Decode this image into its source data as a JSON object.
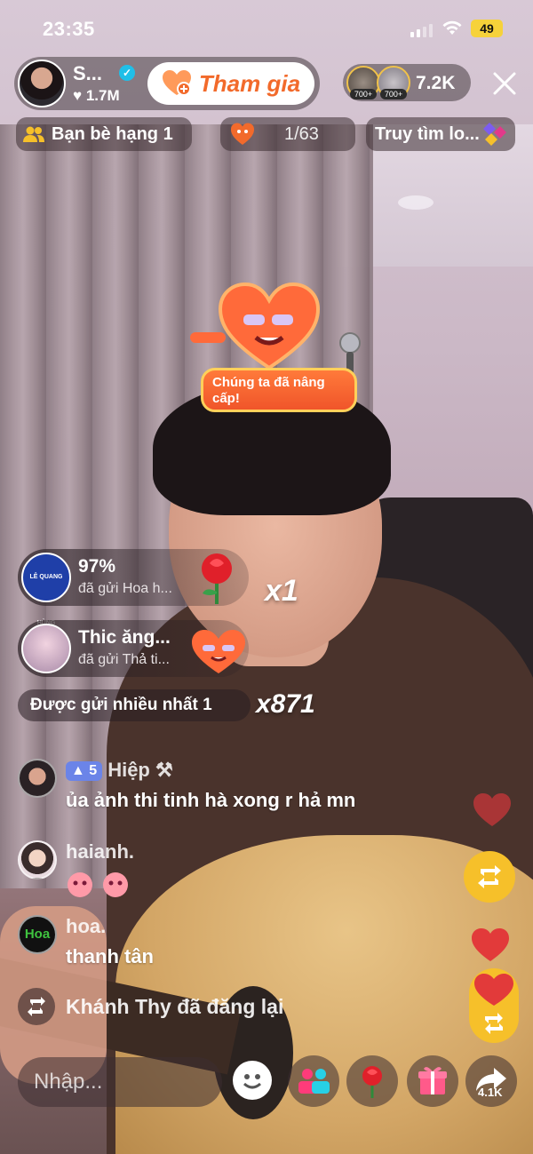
{
  "status": {
    "time": "23:35",
    "battery": "49"
  },
  "host": {
    "name": "S...",
    "likes": "♥ 1.7M",
    "join_label": "Tham gia"
  },
  "viewers": {
    "badge1": "700+",
    "badge2": "700+",
    "count": "7.2K"
  },
  "chips": {
    "friends": "Bạn bè hạng 1",
    "rank": "1/63",
    "search": "Truy tìm lo..."
  },
  "sticker": {
    "label": "Chúng ta đã nâng cấp!"
  },
  "gifts": [
    {
      "title": "97%",
      "sub": "đã gửi Hoa h...",
      "avatar_text": "LÊ QUANG HÙNG",
      "multiplier": "x1"
    },
    {
      "title": "Thic ăng...",
      "sub": "đã gửi Thả ti..."
    }
  ],
  "most_sent": {
    "label": "Được gửi nhiều nhất 1",
    "multiplier": "x871"
  },
  "comments": [
    {
      "level": "5",
      "name": "Hiệp",
      "text": "ủa ảnh thi tinh hà xong r hả mn"
    },
    {
      "name": "haianh.",
      "text": ""
    },
    {
      "name": "hoa.",
      "avatar_text": "Hoa",
      "text": "thanh tân"
    }
  ],
  "repost": {
    "text": "Khánh Thy đã đăng lại"
  },
  "bottom": {
    "input_placeholder": "Nhập...",
    "share_count": "4.1K"
  },
  "colors": {
    "join": "#f26a2b",
    "battery": "#f6d23a",
    "repost": "#f6c02a",
    "heart": "#e23a3a",
    "level_badge": "#6b84e8"
  }
}
